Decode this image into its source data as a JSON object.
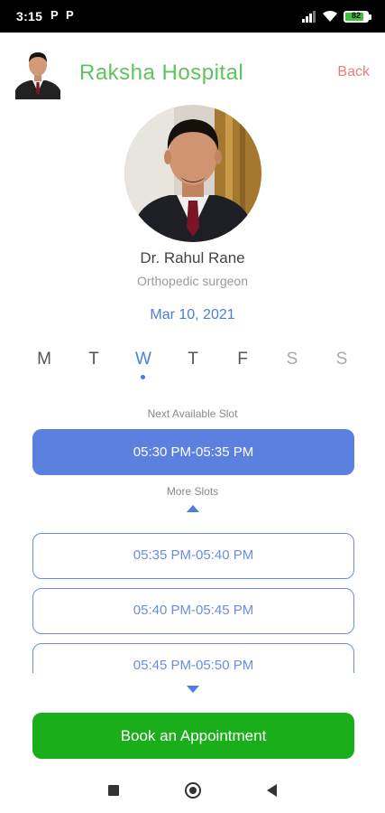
{
  "status_bar": {
    "time": "3:15",
    "app_icons": [
      "P",
      "P"
    ],
    "battery": "82"
  },
  "header": {
    "title": "Raksha Hospital",
    "back_label": "Back"
  },
  "doctor": {
    "name": "Dr. Rahul Rane",
    "specialty": "Orthopedic surgeon"
  },
  "date": "Mar 10, 2021",
  "week": {
    "days": [
      "M",
      "T",
      "W",
      "T",
      "F",
      "S",
      "S"
    ],
    "selected_index": 2
  },
  "slots": {
    "next_caption": "Next Available Slot",
    "next_slot": "05:30 PM-05:35 PM",
    "more_caption": "More Slots",
    "more": [
      "05:35 PM-05:40 PM",
      "05:40 PM-05:45 PM",
      "05:45 PM-05:50 PM"
    ]
  },
  "book_button_label": "Book an Appointment",
  "colors": {
    "accent_blue": "#5b80e0",
    "brand_green": "#5fc45f",
    "book_green": "#1aae1a",
    "back_red": "#ef7b7b"
  },
  "icons": {
    "signal": "signal-icon",
    "wifi": "wifi-icon",
    "battery": "battery-icon",
    "nav_recents": "square-icon",
    "nav_home": "circle-icon",
    "nav_back": "triangle-back-icon"
  }
}
